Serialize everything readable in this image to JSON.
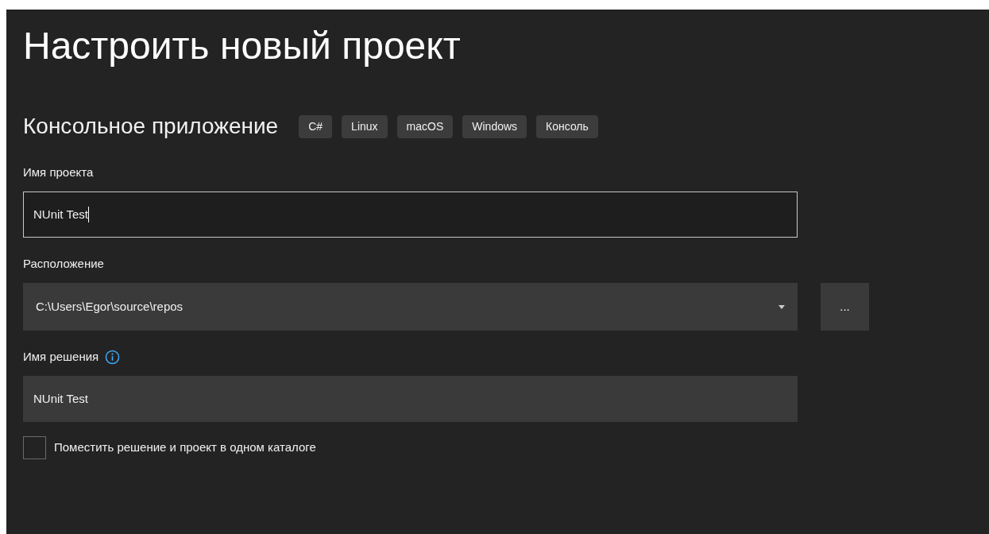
{
  "title": "Настроить новый проект",
  "template": {
    "name": "Консольное приложение",
    "tags": [
      "C#",
      "Linux",
      "macOS",
      "Windows",
      "Консоль"
    ]
  },
  "fields": [
    {
      "kind": "text",
      "label": "Имя проекта",
      "value": "NUnit Test",
      "focused": true
    },
    {
      "kind": "dropdown",
      "label": "Расположение",
      "value": "C:\\Users\\Egor\\source\\repos",
      "browse": "..."
    },
    {
      "kind": "text",
      "label": "Имя решения",
      "value": "NUnit Test",
      "focused": false,
      "info": true
    }
  ],
  "checkbox": {
    "label": "Поместить решение и проект в одном каталоге",
    "checked": false
  }
}
